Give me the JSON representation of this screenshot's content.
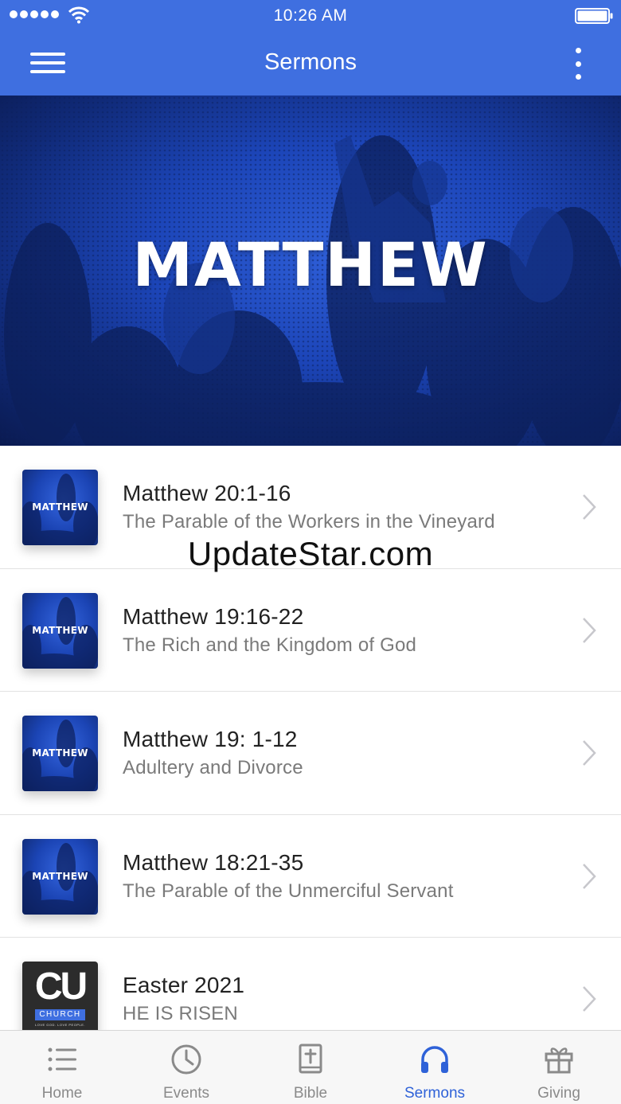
{
  "status_bar": {
    "time": "10:26 AM"
  },
  "header": {
    "title": "Sermons"
  },
  "banner": {
    "title": "MATTHEW"
  },
  "sermons": [
    {
      "title": "Matthew 20:1-16",
      "subtitle": "The Parable of the Workers in the Vineyard",
      "thumb_label": "MATTHEW"
    },
    {
      "title": "Matthew 19:16-22",
      "subtitle": "The Rich and the Kingdom of God",
      "thumb_label": "MATTHEW"
    },
    {
      "title": "Matthew 19: 1-12",
      "subtitle": "Adultery and Divorce",
      "thumb_label": "MATTHEW"
    },
    {
      "title": "Matthew 18:21-35",
      "subtitle": "The Parable of the Unmerciful Servant",
      "thumb_label": "MATTHEW"
    },
    {
      "title": "Easter 2021",
      "subtitle": "HE IS RISEN",
      "thumb_letters": "CU",
      "thumb_label": "CHURCH",
      "thumb_tagline": "LOVE GOD. LOVE PEOPLE."
    }
  ],
  "watermark": "UpdateStar.com",
  "tabs": [
    {
      "label": "Home",
      "icon": "list-icon"
    },
    {
      "label": "Events",
      "icon": "clock-icon"
    },
    {
      "label": "Bible",
      "icon": "bible-icon"
    },
    {
      "label": "Sermons",
      "icon": "headphones-icon",
      "active": true
    },
    {
      "label": "Giving",
      "icon": "gift-icon"
    }
  ],
  "colors": {
    "accent": "#3f6fe0",
    "active_tab": "#2f62d8",
    "inactive_tab": "#8a8a8a"
  }
}
